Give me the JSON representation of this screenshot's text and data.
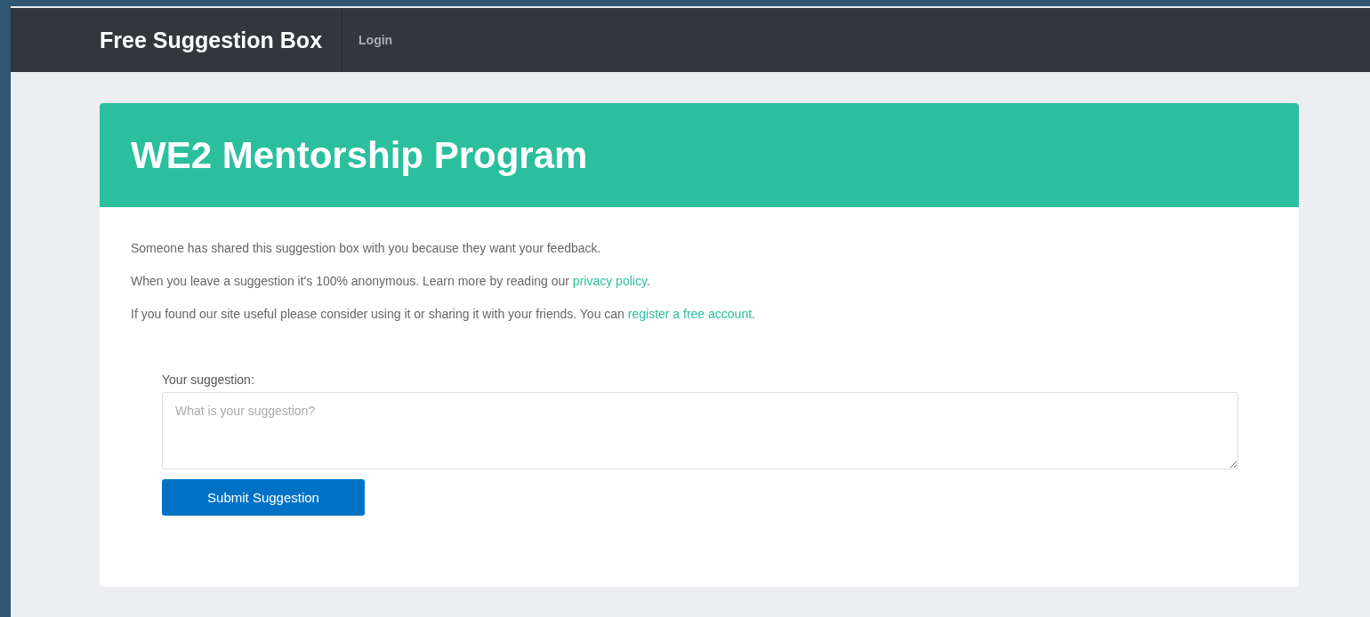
{
  "navbar": {
    "brand": "Free Suggestion Box",
    "links": [
      {
        "label": "Login"
      }
    ]
  },
  "card": {
    "title": "WE2 Mentorship Program",
    "paragraphs": [
      {
        "text": "Someone has shared this suggestion box with you because they want your feedback."
      },
      {
        "text": "When you leave a suggestion it's 100% anonymous. Learn more by reading our ",
        "link": "privacy policy",
        "after": "."
      },
      {
        "text": "If you found our site useful please consider using it or sharing it with your friends. You can ",
        "link": "register a free account",
        "after": "."
      }
    ],
    "form": {
      "label": "Your suggestion:",
      "placeholder": "What is your suggestion?",
      "button": "Submit Suggestion"
    }
  }
}
